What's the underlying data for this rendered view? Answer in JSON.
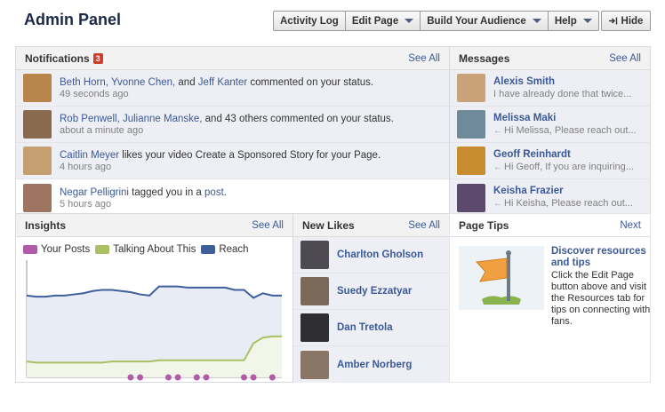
{
  "header": {
    "title": "Admin Panel",
    "toolbar": [
      {
        "label": "Activity Log",
        "dropdown": false
      },
      {
        "label": "Edit Page",
        "dropdown": true
      },
      {
        "label": "Build Your Audience",
        "dropdown": true
      },
      {
        "label": "Help",
        "dropdown": true
      }
    ],
    "hide_label": "Hide"
  },
  "notifications": {
    "title": "Notifications",
    "count": "3",
    "see_all": "See All",
    "items": [
      {
        "links": "Beth Horn, Yvonne Chen,",
        "mid": " and ",
        "link2": "Jeff Kanter",
        "text": " commented on your status.",
        "time": "49 seconds ago",
        "unread": true,
        "avatar": "#b8854d"
      },
      {
        "links": "Rob Penwell, Julianne Manske,",
        "mid": " and 43 others commented on your status.",
        "link2": "",
        "text": "",
        "time": "about a minute ago",
        "unread": true,
        "avatar": "#8a6a4f"
      },
      {
        "links": "Caitlin Meyer",
        "mid": " likes your video Create a Sponsored Story for your Page.",
        "link2": "",
        "text": "",
        "time": "4 hours ago",
        "unread": true,
        "avatar": "#c4a070"
      },
      {
        "links": "Negar Pelligrini",
        "mid": " tagged you in a ",
        "link2": "post",
        "text": ".",
        "time": "5 hours ago",
        "unread": false,
        "avatar": "#9e7560"
      }
    ]
  },
  "messages": {
    "title": "Messages",
    "see_all": "See All",
    "items": [
      {
        "name": "Alexis Smith",
        "snippet": "I have already done that twice...",
        "reply": false,
        "avatar": "#c9a27a"
      },
      {
        "name": "Melissa Maki",
        "snippet": "Hi Melissa, Please reach out...",
        "reply": true,
        "avatar": "#6f8a9a"
      },
      {
        "name": "Geoff Reinhardt",
        "snippet": "Hi Geoff, If you are inquiring...",
        "reply": true,
        "avatar": "#c88b2e"
      },
      {
        "name": "Keisha Frazier",
        "snippet": "Hi Keisha, Please reach out...",
        "reply": true,
        "avatar": "#5b4a6e"
      }
    ]
  },
  "insights": {
    "title": "Insights",
    "see_all": "See All",
    "legend": [
      {
        "label": "Your Posts",
        "color": "#b15ba9"
      },
      {
        "label": "Talking About This",
        "color": "#a9c063"
      },
      {
        "label": "Reach",
        "color": "#3e5f9c"
      }
    ]
  },
  "chart_data": {
    "type": "area",
    "x": [
      0,
      1,
      2,
      3,
      4,
      5,
      6,
      7,
      8,
      9,
      10,
      11,
      12,
      13,
      14,
      15,
      16,
      17,
      18,
      19,
      20,
      21,
      22,
      23,
      24,
      25,
      26,
      27
    ],
    "series": [
      {
        "name": "Reach",
        "color": "#3e5f9c",
        "values": [
          72,
          71,
          71,
          72,
          72,
          73,
          74,
          76,
          77,
          77,
          76,
          75,
          73,
          72,
          80,
          80,
          80,
          79,
          79,
          79,
          79,
          79,
          77,
          77,
          70,
          74,
          72,
          72
        ]
      },
      {
        "name": "Talking About This",
        "color": "#a9c063",
        "values": [
          14,
          13,
          13,
          13,
          13,
          13,
          13,
          13,
          13,
          14,
          14,
          14,
          14,
          14,
          15,
          15,
          15,
          15,
          15,
          15,
          15,
          15,
          15,
          15,
          30,
          35,
          36,
          36
        ]
      },
      {
        "name": "Your Posts",
        "color": "#b15ba9",
        "points": [
          11,
          12,
          15,
          16,
          18,
          19,
          23,
          24,
          26
        ]
      }
    ],
    "ylim": [
      0,
      100
    ]
  },
  "new_likes": {
    "title": "New Likes",
    "see_all": "See All",
    "items": [
      {
        "name": "Charlton Gholson",
        "avatar": "#4d4a52"
      },
      {
        "name": "Suedy Ezzatyar",
        "avatar": "#7b6a5a"
      },
      {
        "name": "Dan Tretola",
        "avatar": "#2f2f33"
      },
      {
        "name": "Amber Norberg",
        "avatar": "#8a7667"
      }
    ]
  },
  "page_tips": {
    "title": "Page Tips",
    "next": "Next",
    "heading": "Discover resources and tips",
    "text": "Click the Edit Page button above and visit the Resources tab for tips on connecting with fans."
  }
}
